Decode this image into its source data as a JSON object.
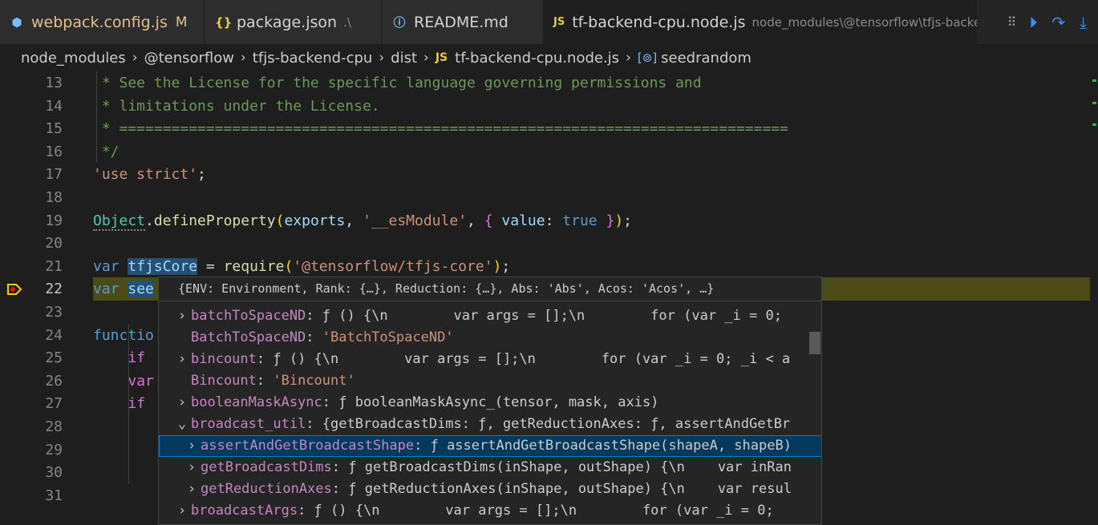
{
  "tabs": [
    {
      "icon": "⬢",
      "icon_color": "#75beff",
      "label": "webpack.config.js",
      "mark": "M",
      "label_color": "#e2c08d"
    },
    {
      "icon": "{}",
      "icon_color": "#e8c94b",
      "label": "package.json",
      "sub": ".\\",
      "label_color": "#cccccc"
    },
    {
      "icon": "ⓘ",
      "icon_color": "#75beff",
      "label": "README.md",
      "label_color": "#cccccc"
    },
    {
      "icon": "JS",
      "icon_color": "#e8c94b",
      "label": "tf-backend-cpu.node.js",
      "sub": "node_modules\\@tensorflow\\tfjs-backe",
      "label_color": "#cccccc",
      "active": true
    }
  ],
  "debug_toolbar": {
    "grip": "⠿",
    "continue": "⏵",
    "step_over": "↷",
    "step_into": "⤓"
  },
  "breadcrumb": {
    "items": [
      "node_modules",
      "@tensorflow",
      "tfjs-backend-cpu",
      "dist"
    ],
    "file_icon": "JS",
    "file": "tf-backend-cpu.node.js",
    "symbol_icon": "[⊚]",
    "symbol": "seedrandom",
    "separator": "›"
  },
  "editor": {
    "current_line": 22,
    "lines": [
      {
        "n": "13",
        "text": " * See the License for the specific language governing permissions and"
      },
      {
        "n": "14",
        "text": " * limitations under the License."
      },
      {
        "n": "15",
        "text": " * ============================================================================="
      },
      {
        "n": "16",
        "text": " */"
      },
      {
        "n": "17",
        "text": "'use strict';"
      },
      {
        "n": "18",
        "text": ""
      },
      {
        "n": "19",
        "text": "Object.defineProperty(exports, '__esModule', { value: true });"
      },
      {
        "n": "20",
        "text": ""
      },
      {
        "n": "21",
        "text": "var tfjsCore = require('@tensorflow/tfjs-core');"
      },
      {
        "n": "22",
        "text": "var see"
      },
      {
        "n": "23",
        "text": ""
      },
      {
        "n": "24",
        "text": "functio"
      },
      {
        "n": "25",
        "text": "    if"
      },
      {
        "n": "26",
        "text": "    var"
      },
      {
        "n": "27",
        "text": "    if"
      },
      {
        "n": "28",
        "text": ""
      },
      {
        "n": "29",
        "text": ""
      },
      {
        "n": "30",
        "text": ""
      },
      {
        "n": "31",
        "text": ""
      }
    ]
  },
  "hover": {
    "header": "{ENV: Environment, Rank: {…}, Reduction: {…}, Abs: 'Abs', Acos: 'Acos', …}",
    "rows": [
      {
        "indent": 0,
        "twist": "›",
        "key": "batchToSpaceND",
        "value": "ƒ () {\\n        var args = [];\\n        for (var _i = 0;",
        "kind": "fn"
      },
      {
        "indent": 0,
        "twist": "",
        "key": "BatchToSpaceND",
        "value": "'BatchToSpaceND'",
        "kind": "str"
      },
      {
        "indent": 0,
        "twist": "›",
        "key": "bincount",
        "value": "ƒ () {\\n        var args = [];\\n        for (var _i = 0; _i < a",
        "kind": "fn"
      },
      {
        "indent": 0,
        "twist": "",
        "key": "Bincount",
        "value": "'Bincount'",
        "kind": "str"
      },
      {
        "indent": 0,
        "twist": "›",
        "key": "booleanMaskAsync",
        "value": "ƒ booleanMaskAsync_(tensor, mask, axis)",
        "kind": "fn"
      },
      {
        "indent": 0,
        "twist": "⌄",
        "key": "broadcast_util",
        "value": "{getBroadcastDims: ƒ, getReductionAxes: ƒ, assertAndGetBr",
        "kind": "fn"
      },
      {
        "indent": 1,
        "twist": "›",
        "key": "assertAndGetBroadcastShape",
        "value": "ƒ assertAndGetBroadcastShape(shapeA, shapeB)",
        "kind": "fn",
        "selected": true
      },
      {
        "indent": 1,
        "twist": "›",
        "key": "getBroadcastDims",
        "value": "ƒ getBroadcastDims(inShape, outShape) {\\n    var inRan",
        "kind": "fn"
      },
      {
        "indent": 1,
        "twist": "›",
        "key": "getReductionAxes",
        "value": "ƒ getReductionAxes(inShape, outShape) {\\n    var resul",
        "kind": "fn"
      },
      {
        "indent": 0,
        "twist": "›",
        "key": "broadcastArgs",
        "value": "ƒ () {\\n        var args = [];\\n        for (var _i = 0;",
        "kind": "fn"
      }
    ]
  }
}
